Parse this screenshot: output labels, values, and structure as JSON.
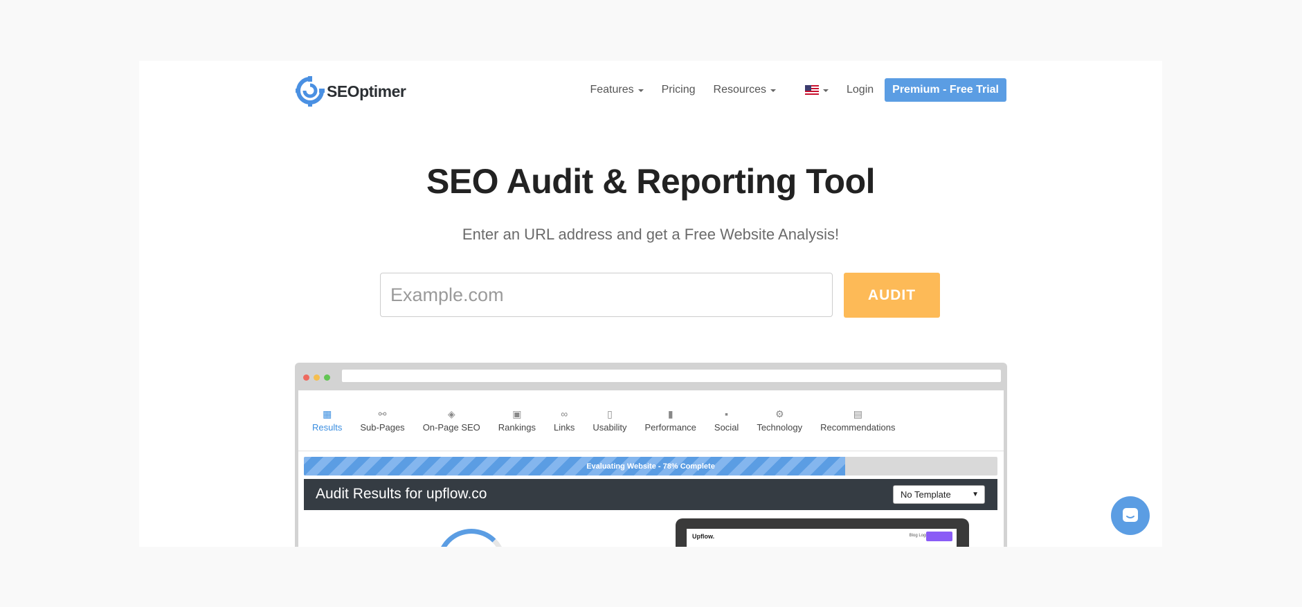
{
  "brand": {
    "logo_text": "SEOptimer",
    "accent": "#5b9de3",
    "audit_color": "#fdba57"
  },
  "nav": {
    "features": "Features",
    "pricing": "Pricing",
    "resources": "Resources",
    "language_icon": "us-flag-icon",
    "login": "Login",
    "trial": "Premium - Free Trial"
  },
  "hero": {
    "title": "SEO Audit & Reporting Tool",
    "subtitle": "Enter an URL address and get a Free Website Analysis!",
    "input_placeholder": "Example.com",
    "audit_button": "AUDIT"
  },
  "preview": {
    "tabs": [
      {
        "label": "Results",
        "icon": "grid-icon"
      },
      {
        "label": "Sub-Pages",
        "icon": "link-nodes-icon"
      },
      {
        "label": "On-Page SEO",
        "icon": "target-icon"
      },
      {
        "label": "Rankings",
        "icon": "image-icon"
      },
      {
        "label": "Links",
        "icon": "chain-icon"
      },
      {
        "label": "Usability",
        "icon": "tablet-icon"
      },
      {
        "label": "Performance",
        "icon": "bar-chart-icon"
      },
      {
        "label": "Social",
        "icon": "folder-icon"
      },
      {
        "label": "Technology",
        "icon": "gears-icon"
      },
      {
        "label": "Recommendations",
        "icon": "clipboard-icon"
      }
    ],
    "progress_text": "Evaluating Website - 78% Complete",
    "progress": 0.78,
    "results_title": "Audit Results for upflow.co",
    "template_select": "No Template",
    "laptop_logo": "Upflow.",
    "laptop_nav": "Blog   Login"
  },
  "chat_icon": "chat-bubble-icon"
}
